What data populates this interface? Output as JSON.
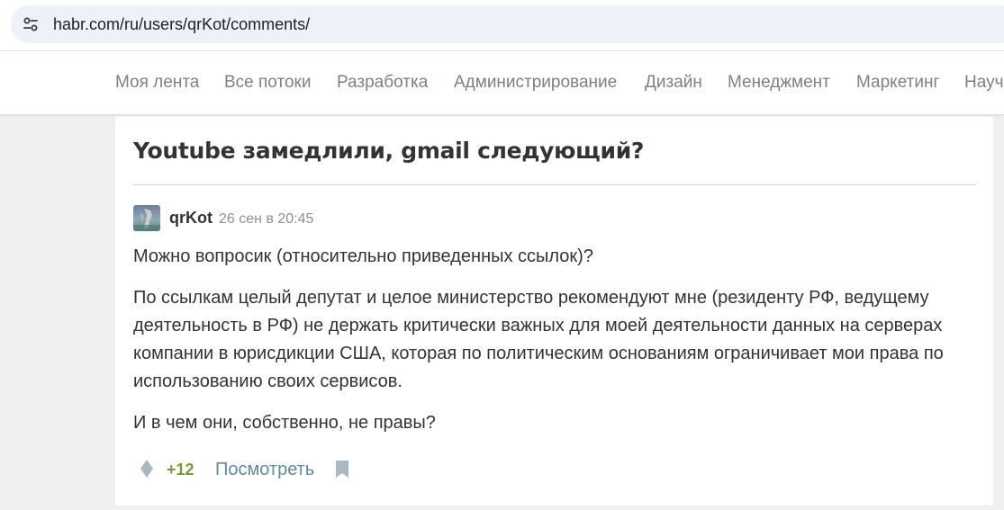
{
  "browser": {
    "url": "habr.com/ru/users/qrKot/comments/",
    "site_info_icon": "tune-icon"
  },
  "nav": {
    "items": [
      {
        "label": "Моя лента"
      },
      {
        "label": "Все потоки"
      },
      {
        "label": "Разработка"
      },
      {
        "label": "Администрирование"
      },
      {
        "label": "Дизайн"
      },
      {
        "label": "Менеджмент"
      },
      {
        "label": "Маркетинг"
      },
      {
        "label": "Науч"
      }
    ]
  },
  "post": {
    "title": "Youtube замедлили, gmail следующий?"
  },
  "comment": {
    "author": "qrKot",
    "timestamp": "26 сен в 20:45",
    "paragraphs": [
      "Можно вопросик (относительно приведенных ссылок)?",
      "По ссылкам целый депутат и целое министерство рекомендуют мне (резиденту РФ, ведущему деятельность в РФ) не держать критически важных для моей деятельности данных на серверах компании в юрисдикции США, которая по политическим основаниям ограничивает мои права по использованию своих сервисов.",
      "И в чем они, собственно, не правы?"
    ],
    "score": "+12",
    "view_label": "Посмотреть",
    "icons": {
      "vote": "vote-diamond-icon",
      "bookmark": "bookmark-icon",
      "avatar": "avatar-image"
    }
  },
  "colors": {
    "page_bg": "#f0f0f0",
    "nav_text": "#7b8287",
    "score": "#7b9a35",
    "link": "#5e8aa6",
    "url_pill": "#eef1f8"
  }
}
